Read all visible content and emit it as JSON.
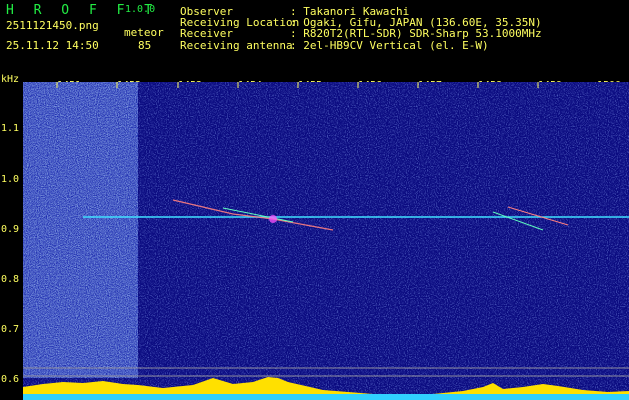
{
  "app": {
    "brand": "H R O F F T",
    "version": "1.0.0"
  },
  "file": {
    "name": "2511121450.png",
    "datetime": "25.11.12 14:50"
  },
  "detection": {
    "label": "meteor",
    "count": "85"
  },
  "station": [
    {
      "key": "Observer",
      "value": ": Takanori Kawachi"
    },
    {
      "key": "Receiving Location",
      "value": ": Ogaki, Gifu, JAPAN (136.60E, 35.35N)"
    },
    {
      "key": "Receiver",
      "value": ": R820T2(RTL-SDR) SDR-Sharp 53.1000MHz"
    },
    {
      "key": "Receiving antenna",
      "value": ": 2el-HB9CV Vertical (el. E-W)"
    }
  ],
  "axis": {
    "y_unit": "kHz",
    "y_ticks": [
      "1.1",
      "1.0",
      "0.9",
      "0.8",
      "0.7",
      "0.6"
    ],
    "x_ticks": [
      "1451",
      "1452",
      "1453",
      "1454",
      "1455",
      "1456",
      "1457",
      "1458",
      "1459",
      "1500"
    ]
  },
  "colors": {
    "text": "#ffff60",
    "brand": "#22ee44",
    "background": "#0a0a80",
    "carrier": "#40e0ff"
  }
}
